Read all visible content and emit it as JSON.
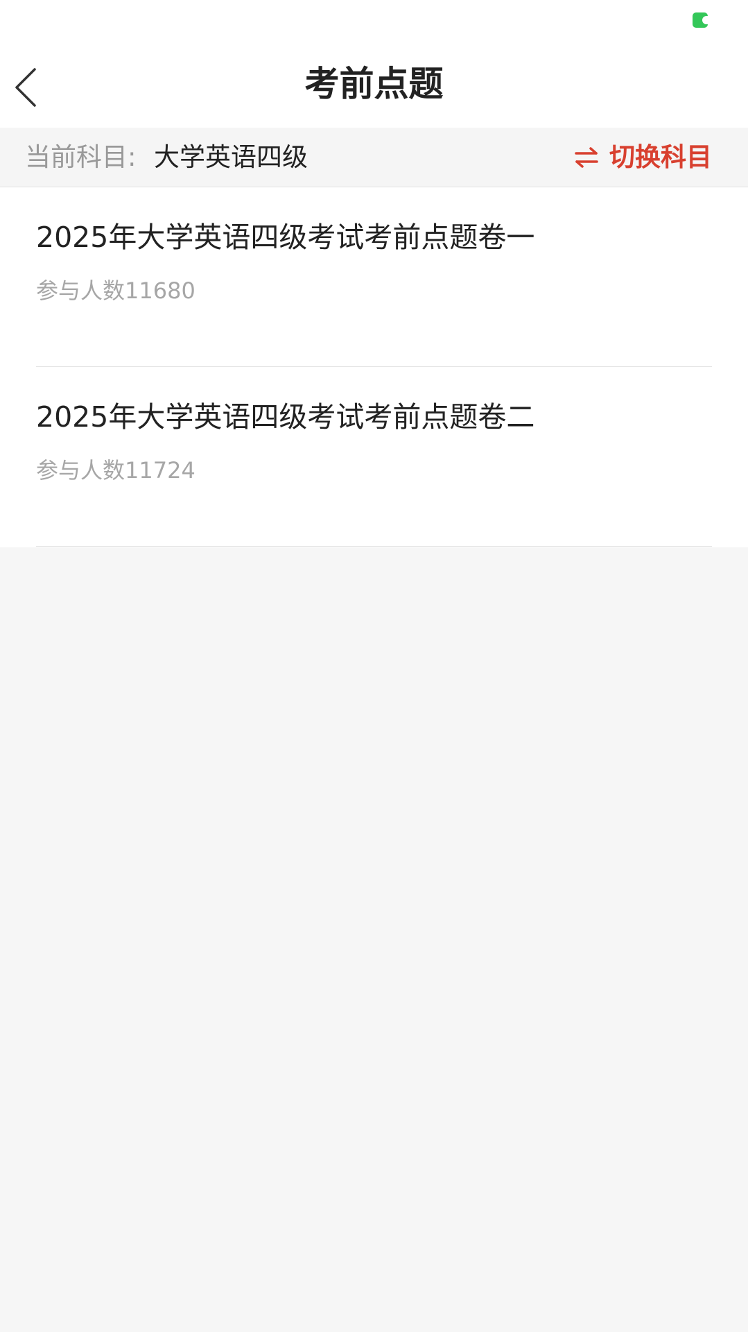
{
  "header": {
    "title": "考前点题",
    "back_icon": "chevron-left-icon"
  },
  "status_bar": {
    "indicator_color": "#34c759"
  },
  "subject_bar": {
    "label": "当前科目:",
    "value": "大学英语四级",
    "switch_label": "切换科目",
    "switch_icon": "swap-arrows-icon",
    "accent_color": "#d8402f"
  },
  "papers": [
    {
      "title": "2025年大学英语四级考试考前点题卷一",
      "participants": "参与人数11680"
    },
    {
      "title": "2025年大学英语四级考试考前点题卷二",
      "participants": "参与人数11724"
    }
  ]
}
